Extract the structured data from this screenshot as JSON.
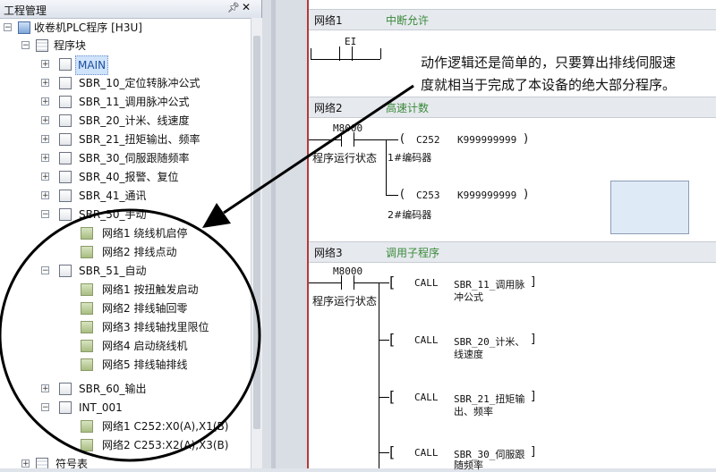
{
  "left_pane": {
    "title": "工程管理",
    "pin_icon": "pin-icon",
    "close_icon": "close-icon"
  },
  "tree": {
    "project": "收卷机PLC程序 [H3U]",
    "program_block": "程序块",
    "items": [
      {
        "label": "MAIN"
      },
      {
        "label": "SBR_10_定位转脉冲公式"
      },
      {
        "label": "SBR_11_调用脉冲公式"
      },
      {
        "label": "SBR_20_计米、线速度"
      },
      {
        "label": "SBR_21_扭矩输出、频率"
      },
      {
        "label": "SBR_30_伺服跟随频率"
      },
      {
        "label": "SBR_40_报警、复位"
      },
      {
        "label": "SBR_41_通讯"
      },
      {
        "label": "SBR_50_手动"
      },
      {
        "label": "网络1 绕线机启停"
      },
      {
        "label": "网络2 排线点动"
      },
      {
        "label": "SBR_51_自动"
      },
      {
        "label": "网络1 按扭触发启动"
      },
      {
        "label": "网络2 排线轴回零"
      },
      {
        "label": "网络3 排线轴找里限位"
      },
      {
        "label": "网络4 启动绕线机"
      },
      {
        "label": "网络5 排线轴排线"
      },
      {
        "label": "SBR_60_输出"
      },
      {
        "label": "INT_001"
      },
      {
        "label": "网络1 C252:X0(A),X1(B)"
      },
      {
        "label": "网络2 C253:X2(A),X3(B)"
      },
      {
        "label": "符号表"
      }
    ]
  },
  "ladder": {
    "net1": {
      "name": "网络1",
      "comment": "中断允许",
      "ei": "EI"
    },
    "net2": {
      "name": "网络2",
      "comment": "高速计数",
      "contact": "M8000",
      "contact_comment": "程序运行状态",
      "coil1_open": "(",
      "coil1_dev": "C252",
      "coil1_val": "K999999999",
      "coil1_close": ")",
      "coil1_comment": "1#编码器",
      "coil2_open": "(",
      "coil2_dev": "C253",
      "coil2_val": "K999999999",
      "coil2_close": ")",
      "coil2_comment": "2#编码器"
    },
    "net3": {
      "name": "网络3",
      "comment": "调用子程序",
      "contact": "M8000",
      "contact_comment": "程序运行状态",
      "calls": [
        {
          "br": "[",
          "cmd": "CALL",
          "line1": "SBR_11_调用脉",
          "line2": "冲公式",
          "end": "]"
        },
        {
          "br": "[",
          "cmd": "CALL",
          "line1": "SBR_20_计米、",
          "line2": "线速度",
          "end": "]"
        },
        {
          "br": "[",
          "cmd": "CALL",
          "line1": "SBR_21_扭矩输",
          "line2": "出、频率",
          "end": "]"
        },
        {
          "br": "[",
          "cmd": "CALL",
          "line1": "SBR_30_伺服跟",
          "line2": "随频率",
          "end": "]"
        }
      ]
    }
  },
  "annotation": {
    "line1": "动作逻辑还是简单的，只要算出排线伺服速",
    "line2": "度就相当于完成了本设备的绝大部分程序。"
  }
}
